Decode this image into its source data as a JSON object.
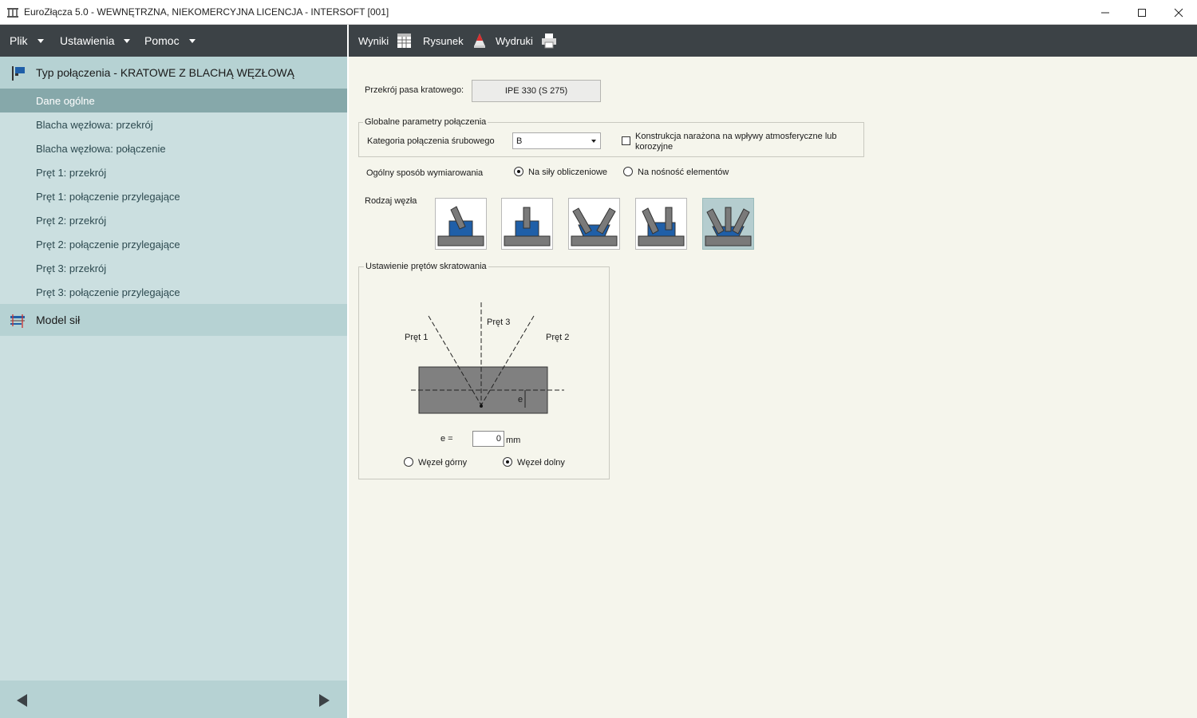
{
  "window": {
    "title": "EuroZłącza 5.0 - WEWNĘTRZNA, NIEKOMERCYJNA LICENCJA - INTERSOFT [001]",
    "app_icon": "building-icon",
    "controls": [
      "minimize-icon",
      "maximize-icon",
      "close-icon"
    ]
  },
  "menubar": {
    "items": [
      {
        "label": "Plik"
      },
      {
        "label": "Ustawienia"
      },
      {
        "label": "Pomoc"
      }
    ]
  },
  "sidebar": {
    "section1": {
      "label": "Typ połączenia - KRATOWE Z BLACHĄ WĘZŁOWĄ",
      "icon": "flag-icon"
    },
    "items": [
      {
        "label": "Dane ogólne",
        "active": true
      },
      {
        "label": "Blacha węzłowa: przekrój"
      },
      {
        "label": "Blacha węzłowa: połączenie"
      },
      {
        "label": "Pręt 1: przekrój"
      },
      {
        "label": "Pręt 1: połączenie przylegające"
      },
      {
        "label": "Pręt 2: przekrój"
      },
      {
        "label": "Pręt 2: połączenie przylegające"
      },
      {
        "label": "Pręt 3: przekrój"
      },
      {
        "label": "Pręt 3: połączenie przylegające"
      }
    ],
    "section2": {
      "label": "Model sił",
      "icon": "force-model-icon"
    },
    "nav": {
      "prev_icon": "arrow-left-icon",
      "next_icon": "arrow-right-icon"
    }
  },
  "toolbar": {
    "items": [
      {
        "label": "Wyniki",
        "icon": "results-table-icon"
      },
      {
        "label": "Rysunek",
        "icon": "drawing-cone-icon"
      },
      {
        "label": "Wydruki",
        "icon": "printer-icon"
      }
    ]
  },
  "form": {
    "profile_label": "Przekrój pasa kratowego:",
    "profile_value": "IPE 330 (S 275)",
    "global_group_label": "Globalne parametry połączenia",
    "bolt_category_label": "Kategoria połączenia śrubowego",
    "bolt_category_value": "B",
    "corrosion_label_line1": "Konstrukcja narażona na wpływy atmosferyczne lub",
    "corrosion_label_line2": "korozyjne",
    "corrosion_checked": false,
    "design_method_label": "Ogólny sposób wymiarowania",
    "design_method_options": [
      "Na siły obliczeniowe",
      "Na nośność elementów"
    ],
    "design_method_selected": "Na siły obliczeniowe",
    "node_type_label": "Rodzaj węzła",
    "node_type_selected_index": 4,
    "bracing_group_label": "Ustawienie prętów skratowania",
    "diagram": {
      "bar1": "Pręt 1",
      "bar2": "Pręt 2",
      "bar3": "Pręt 3",
      "e_symbol": "e",
      "e_label": "e  =",
      "e_value": "0",
      "e_unit": "mm"
    },
    "node_position_options": [
      "Węzeł górny",
      "Węzeł dolny"
    ],
    "node_position_selected": "Węzeł dolny"
  },
  "colors": {
    "dark_bar": "#3c4246",
    "sidebar_bg": "#cbdfe0",
    "section_bg": "#b6d2d3",
    "active_item": "#86a8aa",
    "content_bg": "#f5f5ec",
    "steel_blue": "#1f5fa8",
    "steel_grey": "#7a7a7a"
  }
}
